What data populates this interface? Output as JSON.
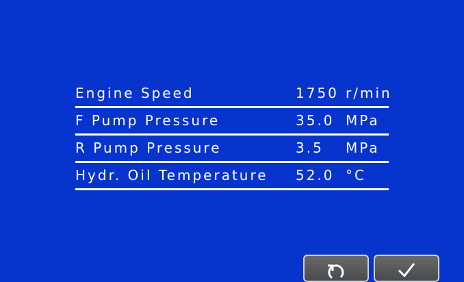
{
  "rows": [
    {
      "label": "Engine Speed",
      "value": "1750",
      "unit": "r/min"
    },
    {
      "label": "F Pump Pressure",
      "value": "35.0",
      "unit": "MPa"
    },
    {
      "label": "R Pump Pressure",
      "value": "3.5",
      "unit": "MPa"
    },
    {
      "label": "Hydr. Oil Temperature",
      "value": "52.0",
      "unit": "°C"
    }
  ],
  "buttons": {
    "back_icon": "return-icon",
    "ok_icon": "checkmark-icon"
  },
  "colors": {
    "background": "#0634cc",
    "text": "#ffffff",
    "button": "#5a5a5a"
  }
}
